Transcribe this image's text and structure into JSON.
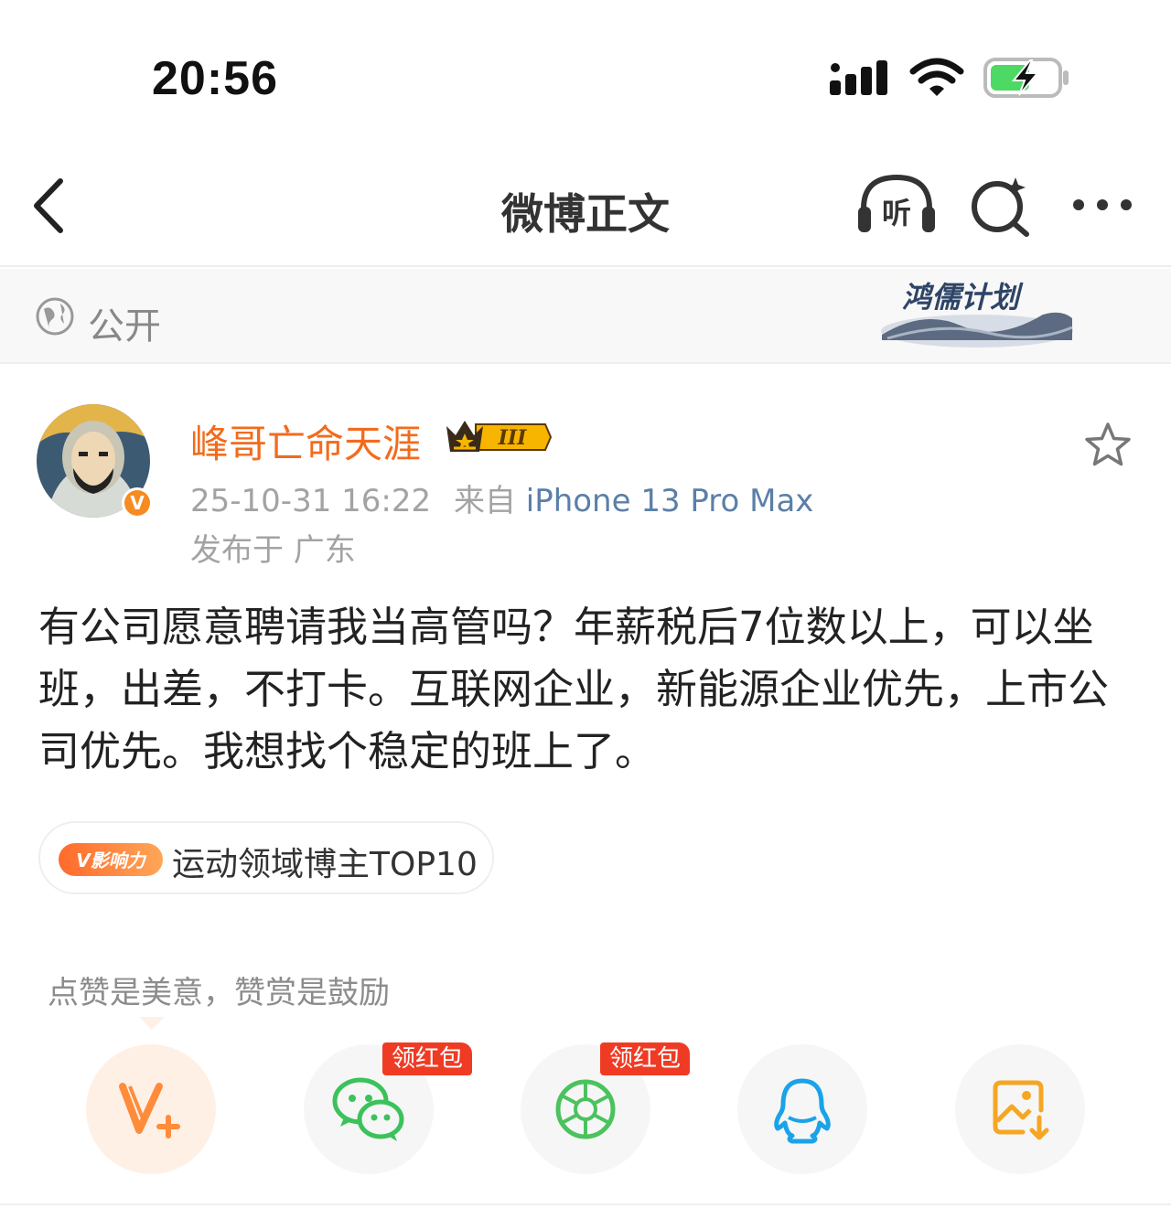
{
  "status_bar": {
    "time": "20:56",
    "signal_icon": "signal-bars-icon",
    "wifi_icon": "wifi-icon",
    "battery_icon": "battery-charging-icon",
    "battery_color": "#4cd964"
  },
  "nav": {
    "back_icon": "chevron-left-icon",
    "title": "微博正文",
    "listen_label": "听",
    "listen_icon": "headphones-icon",
    "search_icon": "search-sparkle-icon",
    "more_icon": "more-dots-icon"
  },
  "visibility": {
    "icon": "globe-icon",
    "label": "公开",
    "banner_text": "鸿儒计划"
  },
  "post": {
    "author": "峰哥亡命天涯",
    "badge_level": "III",
    "verified_mark": "V",
    "date": "25-10-31 16:22",
    "source_prefix": "来自",
    "device": "iPhone 13 Pro Max",
    "location": "发布于 广东",
    "text": "有公司愿意聘请我当高管吗？年薪税后7位数以上，可以坐班，出差，不打卡。互联网企业，新能源企业优先，上市公司优先。我想找个稳定的班上了。",
    "favorite_icon": "star-outline-icon"
  },
  "influence_tag": {
    "badge": "V影响力",
    "label": "运动领域博主TOP10"
  },
  "reward_text": "点赞是美意，赞赏是鼓励",
  "share_buttons": [
    {
      "name": "reward",
      "icon": "v-plus-icon",
      "badge": ""
    },
    {
      "name": "wechat",
      "icon": "wechat-icon",
      "badge": "领红包"
    },
    {
      "name": "moments",
      "icon": "wechat-moments-icon",
      "badge": "领红包"
    },
    {
      "name": "qq",
      "icon": "qq-icon",
      "badge": ""
    },
    {
      "name": "save-image",
      "icon": "save-image-icon",
      "badge": ""
    }
  ],
  "colors": {
    "author": "#f26b1d",
    "device": "#5b7fa8",
    "accent_orange": "#ff8c3a",
    "wechat_green": "#3bc25b",
    "qq_blue": "#1aa3e8",
    "hongbao_red": "#f03b24"
  }
}
